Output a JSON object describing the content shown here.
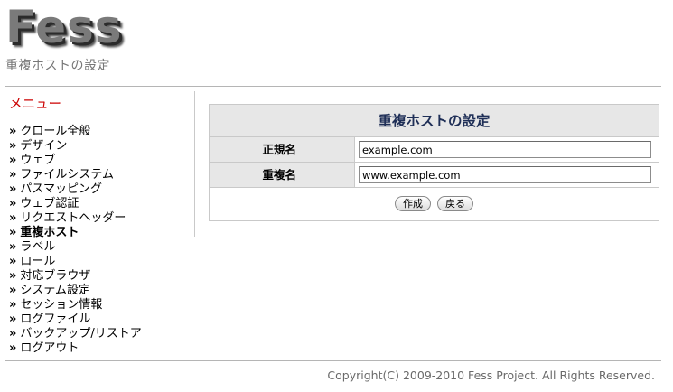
{
  "header": {
    "logo_text": "Fess",
    "page_subtitle": "重複ホストの設定"
  },
  "sidebar": {
    "title": "メニュー",
    "bullet": "»",
    "items": [
      {
        "label": "クロール全般",
        "active": false
      },
      {
        "label": "デザイン",
        "active": false
      },
      {
        "label": "ウェブ",
        "active": false
      },
      {
        "label": "ファイルシステム",
        "active": false
      },
      {
        "label": "パスマッピング",
        "active": false
      },
      {
        "label": "ウェブ認証",
        "active": false
      },
      {
        "label": "リクエストヘッダー",
        "active": false
      },
      {
        "label": "重複ホスト",
        "active": true
      },
      {
        "label": "ラベル",
        "active": false
      },
      {
        "label": "ロール",
        "active": false
      },
      {
        "label": "対応ブラウザ",
        "active": false
      },
      {
        "label": "システム設定",
        "active": false
      },
      {
        "label": "セッション情報",
        "active": false
      },
      {
        "label": "ログファイル",
        "active": false
      },
      {
        "label": "バックアップ/リストア",
        "active": false
      },
      {
        "label": "ログアウト",
        "active": false
      }
    ]
  },
  "form": {
    "title": "重複ホストの設定",
    "regular_name_label": "正規名",
    "regular_name_value": "example.com",
    "duplicate_name_label": "重複名",
    "duplicate_name_value": "www.example.com",
    "create_button": "作成",
    "back_button": "戻る"
  },
  "footer": {
    "copyright": "Copyright(C) 2009-2010 Fess Project. All Rights Reserved."
  },
  "colors": {
    "menu_title": "#cc0000",
    "form_title": "#1f2f57",
    "header_bg": "#e7e7e7",
    "border": "#c9c9c9"
  }
}
